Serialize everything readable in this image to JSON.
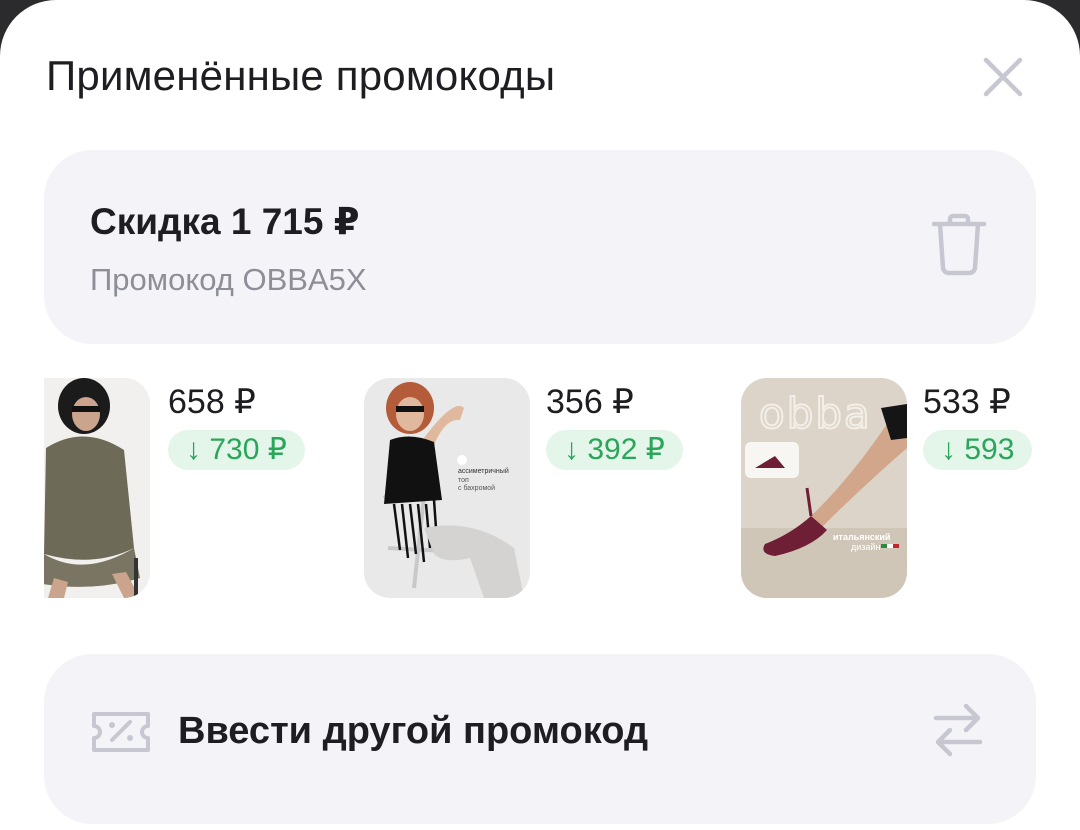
{
  "header": {
    "title": "Применённые промокоды"
  },
  "applied_promo": {
    "discount": "Скидка 1 715 ₽",
    "code": "Промокод OBBA5X"
  },
  "products": [
    {
      "price": "658 ₽",
      "old_price": "↓ 730 ₽",
      "image_desc": "model in olive dress"
    },
    {
      "price": "356 ₽",
      "old_price": "↓ 392 ₽",
      "image_desc": "model in black fringe top",
      "photo_caption": "ассиметричный топ с бахромой"
    },
    {
      "price": "533 ₽",
      "old_price": "↓ 593",
      "image_desc": "burgundy slingback heels",
      "brand_watermark": "obba",
      "photo_caption": "итальянский дизайн"
    }
  ],
  "enter_other": {
    "label": "Ввести другой промокод"
  },
  "colors": {
    "card_bg": "#f4f4f8",
    "badge_bg": "#e4f6ea",
    "badge_text": "#2aa65a",
    "muted_text": "#8e8e99",
    "icon": "#c7c7d2"
  },
  "icons": [
    "close-icon",
    "trash-icon",
    "ticket-percent-icon",
    "swap-icon"
  ]
}
